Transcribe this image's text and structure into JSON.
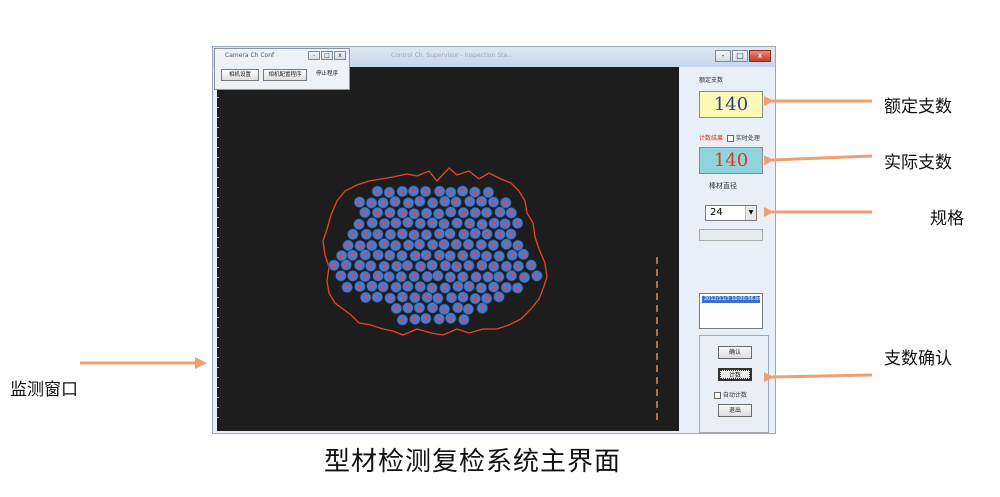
{
  "window": {
    "title": "Control Ch. Supervisor - Inspection Sta...",
    "buttons": [
      "-",
      "□",
      "x"
    ]
  },
  "dialog": {
    "title": "Camera Ch Conf",
    "buttons": [
      "-",
      "□",
      "x"
    ],
    "actions": [
      "相机设置",
      "相机配置程序",
      "停止程序"
    ]
  },
  "panel": {
    "rated_label": "额定支数",
    "rated_value": "140",
    "actual_label": "计数结果",
    "realtime_label": "实时处理",
    "actual_value": "140",
    "diameter_label": "棒材直径",
    "diameter_value": "24",
    "list_item": "2012/11/3 10:00:56.bmp",
    "confirm_button": "确认",
    "count_button": "计数",
    "auto_label": "自动计数",
    "exit_button": "退出"
  },
  "annotations": {
    "rated": "额定支数",
    "actual": "实际支数",
    "spec": "规格",
    "monitor": "监测窗口",
    "confirm": "支数确认"
  },
  "caption": "型材检测复检系统主界面",
  "colors": {
    "arrow": "#f0a070",
    "monitor_bg": "#1d1d1d",
    "contour": "#e8452a",
    "rod_fill": "#4d79c9",
    "rod_center": "#e0454a"
  }
}
